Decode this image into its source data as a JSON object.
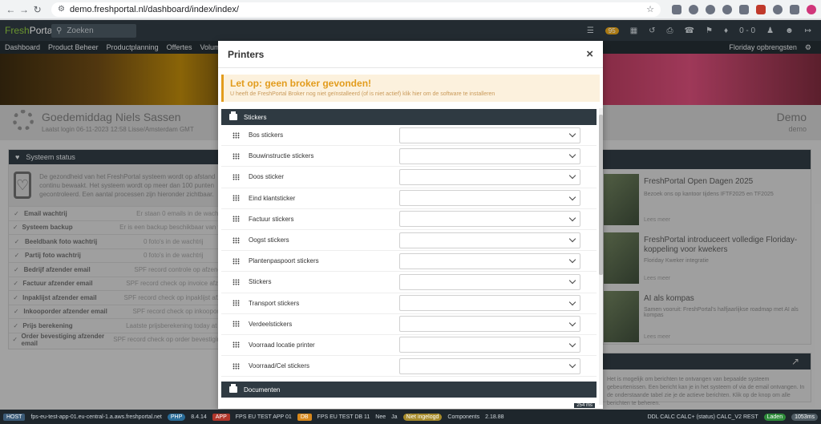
{
  "browser": {
    "url": "demo.freshportal.nl/dashboard/index/index/"
  },
  "header": {
    "logo_fresh": "Fresh",
    "logo_portal": "Portal",
    "search_placeholder": "Zoeken",
    "badge_count": "95",
    "counter": "0 - 0"
  },
  "nav": {
    "items": [
      "Dashboard",
      "Product Beheer",
      "Productplanning",
      "Offertes",
      "Volume"
    ],
    "right_item": "Floriday opbrengsten"
  },
  "dashboard": {
    "greeting": "Goedemiddag Niels Sassen",
    "greeting_sub": "Laatst login 06-11-2023 12:58 Lisse/Amsterdam GMT",
    "company_big": "Demo",
    "company_small": "demo",
    "status_title": "Systeem status",
    "status_intro": "De gezondheid van het FreshPortal systeem wordt op afstand continu bewaakt. Het systeem wordt op meer dan 100 punten gecontroleerd. Een aantal processen zijn hieronder zichtbaar.",
    "status_rows": [
      {
        "label": "Email wachtrij",
        "value": "Er staan 0 emails in de wachtrij"
      },
      {
        "label": "Systeem backup",
        "value": "Er is een backup beschikbaar van vandaag"
      },
      {
        "label": "Beeldbank foto wachtrij",
        "value": "0 foto's in de wachtrij"
      },
      {
        "label": "Partij foto wachtrij",
        "value": "0 foto's in de wachtrij"
      },
      {
        "label": "Bedrijf afzender email",
        "value": "SPF record controle op afzender"
      },
      {
        "label": "Factuur afzender email",
        "value": "SPF record check op invoice afzender"
      },
      {
        "label": "Inpaklijst afzender email",
        "value": "SPF record check op inpaklijst afzender"
      },
      {
        "label": "Inkooporder afzender email",
        "value": "SPF record check op inkooporder"
      },
      {
        "label": "Prijs berekening",
        "value": "Laatste prijsberekening today at 12:00"
      },
      {
        "label": "Order bevestiging afzender email",
        "value": "SPF record check op order bevestiging webshop"
      }
    ],
    "news": [
      {
        "title": "FreshPortal Open Dagen 2025",
        "desc": "Bezoek ons op kantoor tijdens IFTF2025 en TF2025",
        "more": "Lees meer"
      },
      {
        "title": "FreshPortal introduceert volledige Floriday-koppeling voor kwekers",
        "desc": "Floriday Kweker integratie",
        "more": "Lees meer"
      },
      {
        "title": "AI als kompas",
        "desc": "Samen vooruit: FreshPortal's halfjaarlijkse roadmap met AI als kompas",
        "more": "Lees meer"
      }
    ],
    "messages_text": "Het is mogelijk om berichten te ontvangen van bepaalde systeem gebeurtenissen. Een bericht kan je in het systeem of via de email ontvangen. In de onderstaande tabel zie je de actieve berichten. Klik op de knop om alle berichten te beheren."
  },
  "modal": {
    "title": "Printers",
    "close_label": "×",
    "warning_title": "Let op: geen broker gevonden!",
    "warning_text": "U heeft de FreshPortal Broker nog niet geïnstalleerd (of is niet actief) klik hier om de software te installeren",
    "section_stickers": "Stickers",
    "section_documents": "Documenten",
    "rows": [
      {
        "label": "Bos stickers",
        "value": ""
      },
      {
        "label": "Bouwinstructie stickers",
        "value": ""
      },
      {
        "label": "Doos sticker",
        "value": ""
      },
      {
        "label": "Eind klantsticker",
        "value": ""
      },
      {
        "label": "Factuur stickers",
        "value": ""
      },
      {
        "label": "Oogst stickers",
        "value": ""
      },
      {
        "label": "Plantenpaspoort stickers",
        "value": ""
      },
      {
        "label": "Stickers",
        "value": ""
      },
      {
        "label": "Transport stickers",
        "value": ""
      },
      {
        "label": "Verdeelstickers",
        "value": ""
      },
      {
        "label": "Voorraad locatie printer",
        "value": ""
      },
      {
        "label": "Voorraad/Cel stickers",
        "value": ""
      }
    ],
    "timing": "254 ms"
  },
  "statusbar": {
    "host_label": "HOST",
    "host_value": "fps-eu-test-app-01.eu-central-1.a.aws.freshportal.net",
    "version_tag": "PHP",
    "version": "8.4.14",
    "app_label": "APP",
    "app_value": "FPS EU TEST APP 01",
    "db_label": "DB",
    "db_value": "FPS EU TEST DB 11",
    "nee": "Nee",
    "ja": "Ja",
    "warn_label": "Niet ingelogd",
    "components_label": "Components",
    "components_value": "2.18.88",
    "ddl": "DDL CALC CALC+ (status) CALC_V2 REST",
    "green_tag": "Laden",
    "ms_tag": "1053ms"
  },
  "colors": {
    "header": "#2f3a42",
    "warning": "#e29c1d",
    "accent_green": "#8dc63f"
  }
}
